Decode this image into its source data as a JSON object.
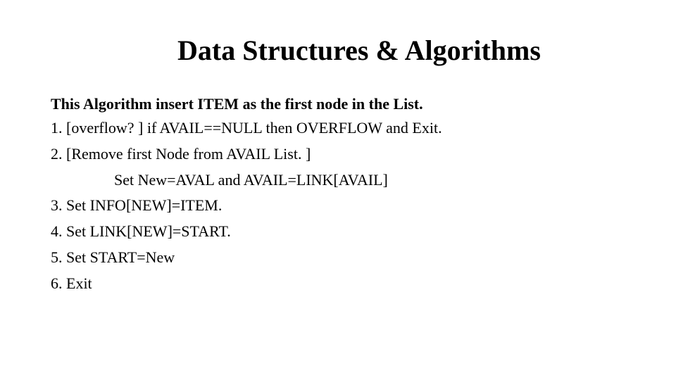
{
  "title": "Data Structures & Algorithms",
  "intro": "This Algorithm insert ITEM as the first node in the List.",
  "steps": {
    "s1": "1.   [overflow? ] if  AVAIL==NULL then OVERFLOW and Exit.",
    "s2": "2.   [Remove first Node from AVAIL List. ]",
    "s2b": "Set New=AVAL  and AVAIL=LINK[AVAIL]",
    "s3": "3. Set INFO[NEW]=ITEM.",
    "s4": "4. Set LINK[NEW]=START.",
    "s5": "5. Set START=New",
    "s6": "6. Exit"
  }
}
